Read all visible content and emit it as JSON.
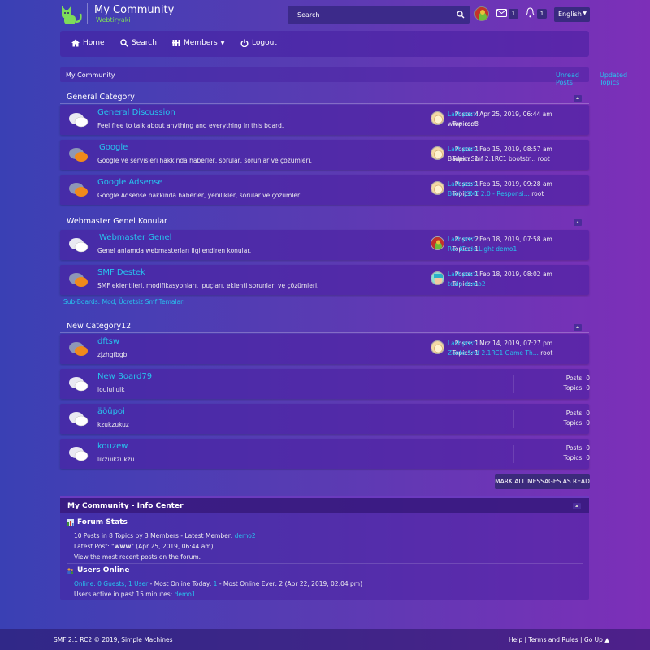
{
  "header": {
    "title": "My Community",
    "subtitle": "Webtiryaki",
    "search_placeholder": "Search",
    "mail_count": "1",
    "alerts_count": "1",
    "language": "English"
  },
  "nav": {
    "items": [
      {
        "label": "Home",
        "icon": "home-icon"
      },
      {
        "label": "Search",
        "icon": "search-icon"
      },
      {
        "label": "Members",
        "icon": "members-icon"
      },
      {
        "label": "Logout",
        "icon": "power-icon"
      }
    ]
  },
  "breadcrumb": {
    "home": "My Community",
    "unread": "Unread Posts",
    "updated": "Updated Topics"
  },
  "categories": [
    {
      "title": "General Category",
      "boards": [
        {
          "name": "General Discussion",
          "desc": "Feel free to talk about anything and everything in this board.",
          "posts": "Posts: 4",
          "topics": "Topics: 3",
          "last_label": "Last post:",
          "last_date": "Apr 25, 2019, 06:44 am",
          "last_topic": "www",
          "last_by": "root"
        },
        {
          "name": "Google",
          "desc": "Google ve servisleri hakkında haberler, sorular, sorunlar ve çözümleri.",
          "posts": "Posts: 1",
          "topics": "Topics: 1",
          "last_label": "Last post:",
          "last_date": "Feb 15, 2019, 08:57 am",
          "last_topic": "Badem Smf 2.1RC1 bootstr...",
          "last_by": "root"
        },
        {
          "name": "Google Adsense",
          "desc": "Google Adsense hakkında haberler, yenilikler, sorular ve çözümler.",
          "posts": "Posts: 1",
          "topics": "Topics: 1",
          "last_label": "Last post:",
          "last_date": "Feb 15, 2019, 09:28 am",
          "last_topic": "Börü [SMF 2.0 - Responsi...",
          "last_by": "root"
        }
      ]
    },
    {
      "title": "Webmaster Genel Konular",
      "boards": [
        {
          "name": "Webmaster Genel",
          "desc": "Genel anlamda webmasterları ilgilendiren konular.",
          "posts": "Posts: 2",
          "topics": "Topics: 1",
          "last_label": "Last post:",
          "last_date": "Feb 18, 2019, 07:58 am",
          "last_topic": "Re: iCode Light",
          "last_by": "demo1"
        },
        {
          "name": "SMF Destek",
          "desc": "SMF eklentileri, modifikasyonları, ipuçları, eklenti sorunları ve çözümleri.",
          "posts": "Posts: 1",
          "topics": "Topics: 1",
          "last_label": "Last post:",
          "last_date": "Feb 18, 2019, 08:02 am",
          "last_topic": "tesla",
          "last_by": "demo2"
        }
      ],
      "subboards_label": "Sub-Boards:",
      "subboards": "Mod, Ücretsiz Smf Temaları"
    },
    {
      "title": "New Category12",
      "boards": [
        {
          "name": "dftsw",
          "desc": "zjzhgfbgb",
          "posts": "Posts: 1",
          "topics": "Topics: 1",
          "last_label": "Last post:",
          "last_date": "Mrz 14, 2019, 07:27 pm",
          "last_topic": "Zento Smf 2.1RC1 Game Th...",
          "last_by": "root"
        },
        {
          "name": "New Board79",
          "desc": "iouluiluik",
          "posts": "Posts: 0",
          "topics": "Topics: 0"
        },
        {
          "name": "äöüpoi",
          "desc": "kzukzukuz",
          "posts": "Posts: 0",
          "topics": "Topics: 0"
        },
        {
          "name": "kouzew",
          "desc": "likzuikzukzu",
          "posts": "Posts: 0",
          "topics": "Topics: 0"
        }
      ]
    }
  ],
  "mark_read": "MARK ALL MESSAGES AS READ",
  "info_center": {
    "title": "My Community - Info Center",
    "forum_stats_title": "Forum Stats",
    "stats_line": "10 Posts in 8 Topics by 3 Members - Latest Member:",
    "latest_member": "demo2",
    "latest_post_prefix": "Latest Post: \"",
    "latest_post_topic": "www",
    "latest_post_suffix": "\" (Apr 25, 2019, 06:44 am)",
    "recent_link": "View the most recent posts on the forum.",
    "users_online_title": "Users Online",
    "online_link": "Online: 0 Guests, 1 User",
    "online_rest_a": "- Most Online Today:",
    "online_today": "1",
    "online_rest_b": "- Most Online Ever: 2 (Apr 22, 2019, 02:04 pm)",
    "active_prefix": "Users active in past 15 minutes:",
    "active_user": "demo1"
  },
  "footer": {
    "copyright": "SMF 2.1 RC2 © 2019, Simple Machines",
    "links": "Help | Terms and Rules | Go Up ▲"
  }
}
